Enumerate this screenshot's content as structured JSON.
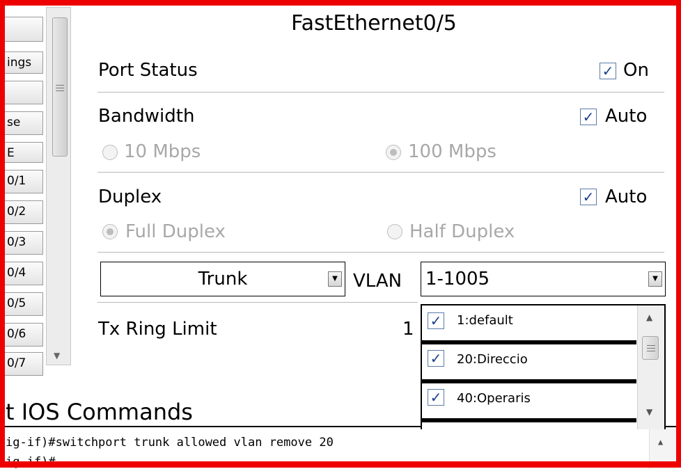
{
  "sidebar": {
    "items": [
      "",
      "ings",
      "",
      "se",
      "E",
      "0/1",
      "0/2",
      "0/3",
      "0/4",
      "0/5",
      "0/6",
      "0/7"
    ]
  },
  "panel": {
    "title": "FastEthernet0/5",
    "port_status": {
      "label": "Port Status",
      "check_label": "On",
      "checked": true
    },
    "bandwidth": {
      "label": "Bandwidth",
      "check_label": "Auto",
      "checked": true,
      "options": [
        "10 Mbps",
        "100 Mbps"
      ],
      "selected": "100 Mbps"
    },
    "duplex": {
      "label": "Duplex",
      "check_label": "Auto",
      "checked": true,
      "options": [
        "Full Duplex",
        "Half Duplex"
      ],
      "selected": "Full Duplex"
    },
    "mode_select": {
      "value": "Trunk"
    },
    "vlan": {
      "label": "VLAN",
      "value": "1-1005"
    },
    "tx_ring": {
      "label": "Tx Ring Limit",
      "value": "1"
    },
    "vlan_list": [
      {
        "label": "1:default",
        "checked": true
      },
      {
        "label": "20:Direccio",
        "checked": true
      },
      {
        "label": "40:Operaris",
        "checked": true
      }
    ]
  },
  "commands": {
    "heading": "t IOS Commands",
    "lines": [
      "ig-if)#switchport trunk allowed vlan remove 20",
      "ig-if)#"
    ]
  },
  "colors": {
    "frame": "#ee0000",
    "check": "#1a3d8c"
  },
  "icons": [
    "check-icon",
    "scroll-up-arrow-icon",
    "scroll-down-arrow-icon",
    "dropdown-arrow-icon"
  ]
}
